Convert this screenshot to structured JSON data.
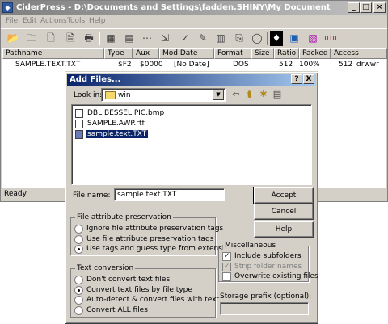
{
  "app": {
    "title": "CiderPress - D:\\Documents and Settings\\fadden.SHINY\\My Documents\\cpt\\testdisk.do (Disk Image - ...",
    "icon": "ciderpress-app-icon"
  },
  "menu": [
    "File",
    "Edit",
    "Actions",
    "Tools",
    "Help"
  ],
  "columns": [
    "Pathname",
    "Type",
    "Aux",
    "Mod Date",
    "Format",
    "Size",
    "Ratio",
    "Packed",
    "Access"
  ],
  "rows": [
    [
      "SAMPLE.TEXT.TXT",
      "$F2",
      "$0000",
      "[No Date]",
      "DOS",
      "512",
      "100%",
      "512",
      "drwwr"
    ]
  ],
  "status": "Ready",
  "dialog": {
    "title": "Add Files...",
    "help_btn": "?",
    "close_btn": "X",
    "look_in_label": "Look in:",
    "look_in_value": "win",
    "files": [
      "DBL.BESSEL.PIC.bmp",
      "SAMPLE.AWP.rtf",
      "sample.text.TXT"
    ],
    "selected_index": 2,
    "file_name_label": "File name:",
    "file_name_value": "sample.text.TXT",
    "accept": "Accept",
    "cancel": "Cancel",
    "help": "Help",
    "attr_group": {
      "label": "File attribute preservation",
      "options": [
        "Ignore file attribute preservation tags",
        "Use file attribute preservation tags",
        "Use tags and guess type from extension"
      ],
      "selected": 2
    },
    "text_group": {
      "label": "Text conversion",
      "options": [
        "Don't convert text files",
        "Convert text files by file type",
        "Auto-detect & convert files with text",
        "Convert ALL files"
      ],
      "selected": 1
    },
    "misc_group": {
      "label": "Miscellaneous",
      "include_subfolders": "Include subfolders",
      "strip_folder_names": "Strip folder names",
      "overwrite_existing": "Overwrite existing files"
    },
    "storage_prefix_label": "Storage prefix (optional):",
    "storage_prefix_value": ""
  }
}
